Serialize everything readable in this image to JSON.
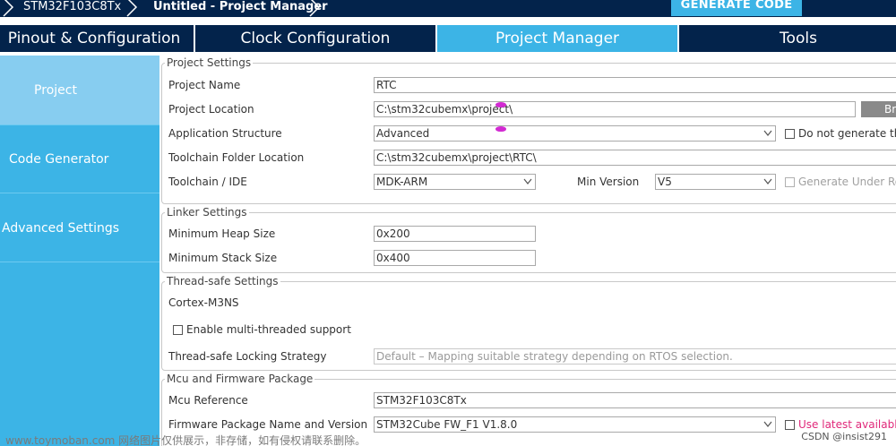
{
  "breadcrumb": {
    "device": "STM32F103C8Tx",
    "project": "Untitled - Project Manager",
    "generate_button": "GENERATE CODE"
  },
  "tabs": [
    {
      "label": "Pinout & Configuration",
      "active": false
    },
    {
      "label": "Clock Configuration",
      "active": false
    },
    {
      "label": "Project Manager",
      "active": true
    },
    {
      "label": "Tools",
      "active": false
    }
  ],
  "sidebar": {
    "items": [
      {
        "label": "Project",
        "active": true
      },
      {
        "label": "Code Generator",
        "active": false
      },
      {
        "label": "Advanced Settings",
        "active": false
      }
    ]
  },
  "project_settings": {
    "title": "Project Settings",
    "project_name_label": "Project Name",
    "project_name_value": "RTC",
    "project_location_label": "Project Location",
    "project_location_value": "C:\\stm32cubemx\\project\\",
    "browse_label": "Bro",
    "app_structure_label": "Application Structure",
    "app_structure_value": "Advanced",
    "do_not_generate_label": "Do not generate the r",
    "toolchain_folder_label": "Toolchain Folder Location",
    "toolchain_folder_value": "C:\\stm32cubemx\\project\\RTC\\",
    "toolchain_ide_label": "Toolchain / IDE",
    "toolchain_ide_value": "MDK-ARM",
    "min_version_label": "Min Version",
    "min_version_value": "V5",
    "generate_under_root_label": "Generate Under Root"
  },
  "linker_settings": {
    "title": "Linker Settings",
    "heap_label": "Minimum Heap Size",
    "heap_value": "0x200",
    "stack_label": "Minimum Stack Size",
    "stack_value": "0x400"
  },
  "thread_safe": {
    "title": "Thread-safe Settings",
    "core": "Cortex-M3NS",
    "multithread_label": "Enable multi-threaded support",
    "strategy_label": "Thread-safe Locking Strategy",
    "strategy_value": "Default  –  Mapping suitable strategy depending on RTOS selection."
  },
  "mcu_firmware": {
    "title": "Mcu and Firmware Package",
    "mcu_ref_label": "Mcu Reference",
    "mcu_ref_value": "STM32F103C8Tx",
    "fw_pkg_label": "Firmware Package Name and Version",
    "fw_pkg_value": "STM32Cube FW_F1 V1.8.0",
    "use_latest_label": "Use latest available ve"
  },
  "footer": {
    "watermark": "www.toymoban.com 网络图片仅供展示，非存储，如有侵权请联系删除。",
    "credit": "CSDN @insist291"
  },
  "colors": {
    "navy": "#03234b",
    "accent": "#3cb4e6",
    "sidebar_active": "#87cdf0",
    "cursor_marker": "#d22ad2"
  }
}
